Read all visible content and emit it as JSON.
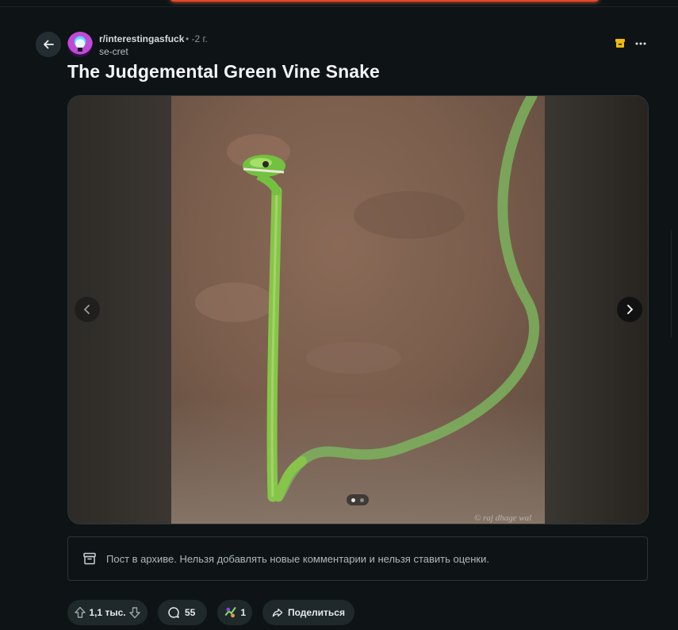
{
  "post": {
    "subreddit": "r/interestingasfuck",
    "age": "• -2 г.",
    "author": "se-cret",
    "title": "The Judgemental Green Vine Snake"
  },
  "gallery": {
    "current_index": 1,
    "total": 2,
    "watermark": "© raj dhage wal"
  },
  "archived_notice": "Пост в архиве. Нельзя добавлять новые комментарии и нельзя ставить оценки.",
  "actions": {
    "votes": "1,1 тыс.",
    "comments": "55",
    "awards": "1",
    "share_label": "Поделиться"
  },
  "colors": {
    "background": "#0e1416",
    "pill": "#1f282b",
    "archive_badge": "#f0b90b",
    "accent_top": "#e8452a"
  },
  "icons": [
    "back-arrow-icon",
    "archive-icon",
    "more-icon",
    "chevron-left-icon",
    "chevron-right-icon",
    "upvote-icon",
    "downvote-icon",
    "comment-icon",
    "award-icon",
    "share-icon"
  ]
}
